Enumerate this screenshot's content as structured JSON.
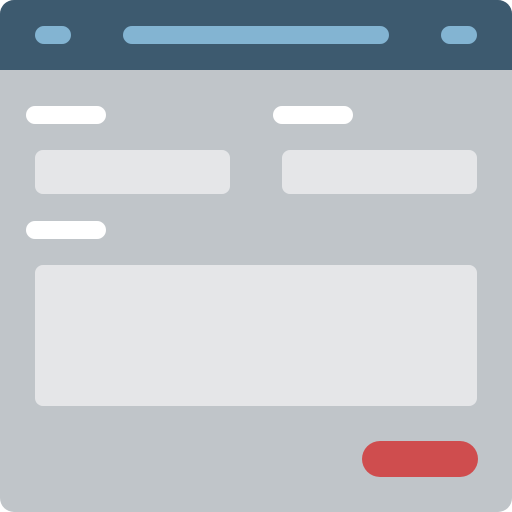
{
  "titlebar": {
    "left_control": "",
    "title": "",
    "right_control": ""
  },
  "form": {
    "label_1": "",
    "field_1_value": "",
    "label_2": "",
    "field_2_value": "",
    "label_3": "",
    "textarea_value": "",
    "submit_label": ""
  },
  "colors": {
    "titlebar": "#3d5a6f",
    "titlebar_pills": "#83b4d2",
    "window_bg": "#c0c5c9",
    "label": "#ffffff",
    "field_bg": "#e5e6e8",
    "submit_button": "#cf4d4e"
  }
}
